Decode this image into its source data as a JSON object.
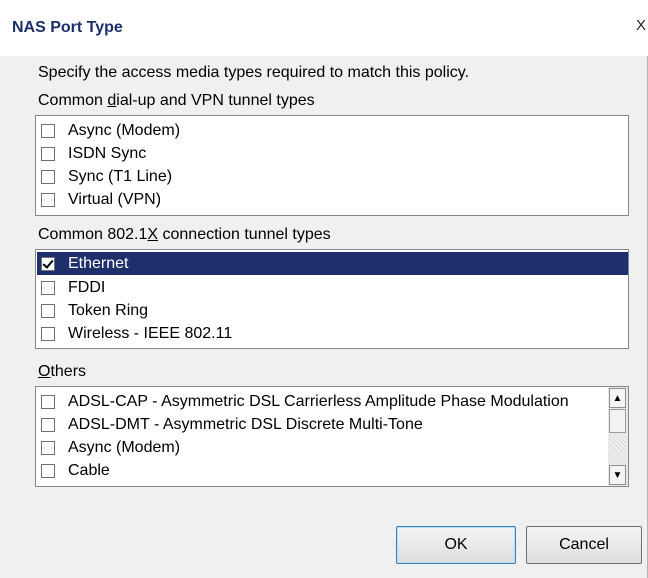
{
  "dialog": {
    "title": "NAS Port Type",
    "close_label": "X",
    "prompt": "Specify the access media types required to match this policy."
  },
  "groups": {
    "dialup": {
      "label_before": "Common ",
      "label_accel": "d",
      "label_after": "ial-up and VPN tunnel types",
      "items": [
        {
          "label": "Async (Modem)",
          "checked": false
        },
        {
          "label": "ISDN Sync",
          "checked": false
        },
        {
          "label": "Sync (T1 Line)",
          "checked": false
        },
        {
          "label": "Virtual (VPN)",
          "checked": false
        }
      ]
    },
    "dot1x": {
      "label_before": "Common 802.1",
      "label_accel": "X",
      "label_after": " connection tunnel types",
      "items": [
        {
          "label": "Ethernet",
          "checked": true,
          "selected": true
        },
        {
          "label": "FDDI",
          "checked": false
        },
        {
          "label": "Token Ring",
          "checked": false
        },
        {
          "label": "Wireless - IEEE 802.11",
          "checked": false
        }
      ]
    },
    "others": {
      "label_accel": "O",
      "label_after": "thers",
      "items": [
        {
          "label": "ADSL-CAP - Asymmetric DSL Carrierless Amplitude Phase Modulation",
          "checked": false
        },
        {
          "label": "ADSL-DMT - Asymmetric DSL Discrete Multi-Tone",
          "checked": false
        },
        {
          "label": "Async (Modem)",
          "checked": false
        },
        {
          "label": "Cable",
          "checked": false
        }
      ]
    }
  },
  "buttons": {
    "ok": "OK",
    "cancel": "Cancel"
  },
  "colors": {
    "selection": "#1f2f6b",
    "title_text": "#1a2f6b"
  }
}
